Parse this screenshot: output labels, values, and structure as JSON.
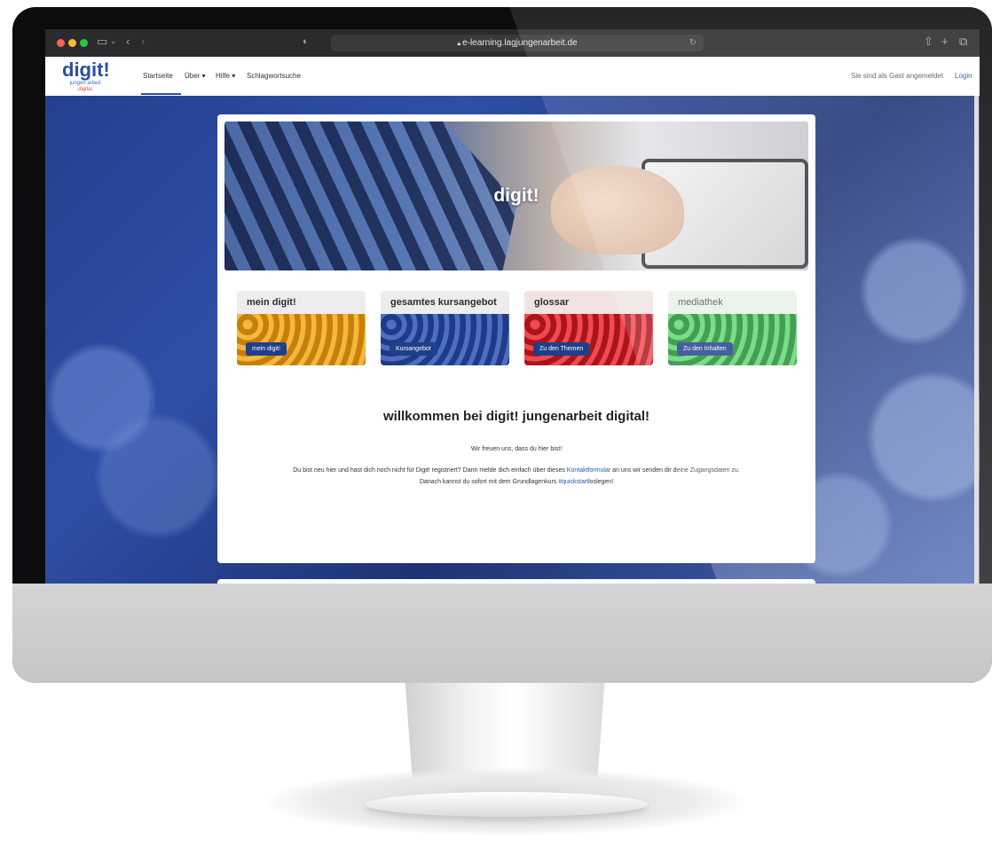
{
  "browser": {
    "url": "e-learning.lagjungenarbeit.de"
  },
  "site": {
    "logo": {
      "main": "digit!",
      "sub_line1": "jungen",
      "sub_line2": "arbeit",
      "sub_line3": "digital"
    },
    "nav": [
      {
        "label": "Startseite"
      },
      {
        "label": "Über ▾"
      },
      {
        "label": "Hilfe ▾"
      },
      {
        "label": "Schlagwortsuche"
      }
    ],
    "guest_notice": "Sie sind als Gast angemeldet",
    "login_label": "Login"
  },
  "hero": {
    "title": "digit!"
  },
  "tiles": [
    {
      "title": "mein digit!",
      "button": "mein digit!",
      "color": "#e7a21a"
    },
    {
      "title": "gesamtes kursangebot",
      "button": "Kursangebot",
      "color": "#2a4fa3"
    },
    {
      "title": "glossar",
      "button": "Zu den Themen",
      "color": "#d8262d"
    },
    {
      "title": "mediathek",
      "button": "Zu den Inhalten",
      "color": "#35b94a"
    }
  ],
  "welcome": {
    "title": "willkommen bei digit! jungenarbeit digital!",
    "line1": "Wir freuen uns, dass du hier bist!",
    "line2_pre": "Du bist neu hier und hast dich noch nicht für Digit! registriert? Dann melde dich einfach über dieses",
    "line2_link": "Kontaktformular",
    "line2_post": "an uns wir senden dir deine Zugangsdaten zu.",
    "line3_pre": "Danach kannst du sofort mit dem Grundlagenkurs",
    "line3_link": "#quickstart",
    "line3_post": "loslegen!"
  },
  "icons": {
    "sidebar": "sidebar-icon",
    "back": "back-arrow-icon",
    "forward": "forward-arrow-icon",
    "shield": "shield-icon",
    "lock": "lock-icon",
    "share": "share-icon",
    "new_tab": "plus-icon",
    "tabs": "tabs-icon"
  }
}
